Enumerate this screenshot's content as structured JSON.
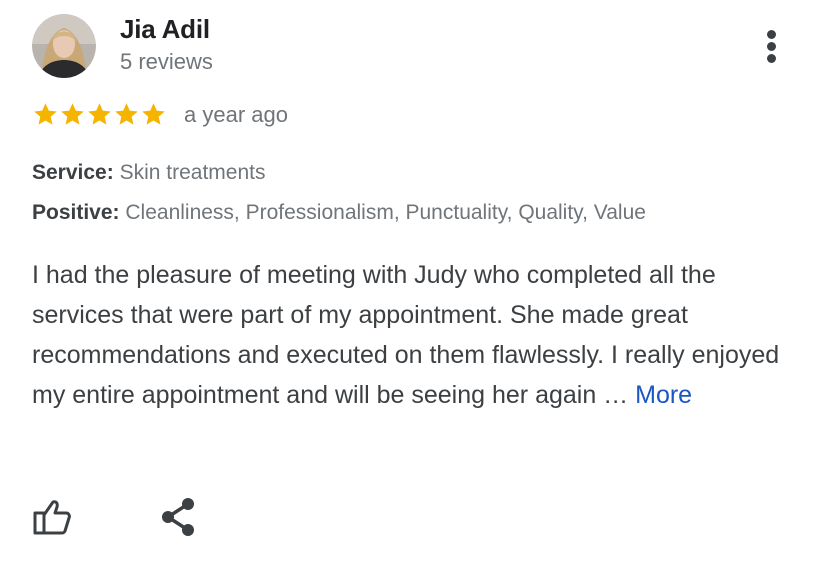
{
  "reviewer": {
    "name": "Jia Adil",
    "reviews_count": "5 reviews",
    "avatar_icon": "user-avatar-photo"
  },
  "rating": {
    "stars": 5,
    "max_stars": 5,
    "star_color": "#f4b400",
    "time_ago": "a year ago"
  },
  "attributes": {
    "service_label": "Service:",
    "service_value": "Skin treatments",
    "positive_label": "Positive:",
    "positive_value": "Cleanliness, Professionalism, Punctuality, Quality, Value"
  },
  "review": {
    "text": "I had the pleasure of meeting with Judy who completed all the services that were part of my appointment. She made great recommendations and executed on them flawlessly. I really enjoyed my entire appointment and will be seeing her again … ",
    "more_label": "More",
    "link_color": "#1a56c4"
  },
  "actions": {
    "like_icon": "thumbs-up-icon",
    "share_icon": "share-icon",
    "menu_icon": "more-vert-icon"
  }
}
